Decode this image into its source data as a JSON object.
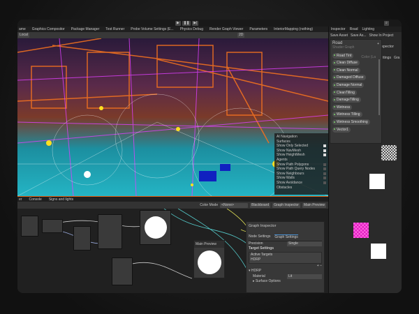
{
  "toolbar": {
    "play": "▶",
    "pause": "❚❚",
    "step": "▶|"
  },
  "tabs": [
    "ame",
    "Graphics Compositor",
    "Package Manager",
    "Test Runner",
    "Probe Volume Settings (E...",
    "Physics Debug",
    "Render Graph Viewer",
    "Parameters",
    "InteriorMapping (nothing)"
  ],
  "right_tabs": [
    "Inspector",
    "Road",
    "Lighting"
  ],
  "right_toolbar": [
    "Save Asset",
    "Save As...",
    "Show In Project"
  ],
  "scene_toolbar": {
    "view": "Local",
    "mode2d": "2D"
  },
  "navigation": {
    "title": "AI Navigation",
    "surfaces": "Surfaces",
    "surface_items": [
      "Show Only Selected",
      "Show NavMesh",
      "Show HeightMesh"
    ],
    "agents": "Agents",
    "agent_items": [
      "Show Path Polygons",
      "Show Path Query Nodes",
      "Show Neighbours",
      "Show Walls",
      "Show Avoidance"
    ],
    "obstacles": "Obstacles"
  },
  "blackboard": {
    "title": "Road",
    "subtitle": "Shader Graph",
    "properties": [
      "Road Tint",
      "Clean Diffuse",
      "Clean Normal",
      "Damaged Diffuse",
      "Damage Normal",
      "CleanTilling",
      "DamageTilling",
      "Wetness",
      "Wetness Tilling",
      "Wetness Smoothing",
      "Vector1"
    ],
    "type_hint": "Color (La"
  },
  "inspector_peek": {
    "title": "spector",
    "tabs": [
      "ttings",
      "Gra"
    ]
  },
  "bottom_tabs": [
    "er",
    "Console",
    "Signs and lights"
  ],
  "graph_toolbar": {
    "color_mode_label": "Color Mode",
    "color_mode": "<None>",
    "buttons": [
      "Blackboard",
      "Graph Inspector",
      "Main Preview"
    ]
  },
  "main_preview": {
    "title": "Main Preview"
  },
  "graph_inspector": {
    "title": "Graph Inspector",
    "tabs": [
      "Node Settings",
      "Graph Settings"
    ],
    "precision_label": "Precision",
    "precision": "Single",
    "target_settings": "Target Settings",
    "active_targets": "Active Targets",
    "target": "HDRP",
    "section": "HDRP",
    "material_label": "Material",
    "material": "Lit",
    "surface_options": "Surface Options"
  }
}
